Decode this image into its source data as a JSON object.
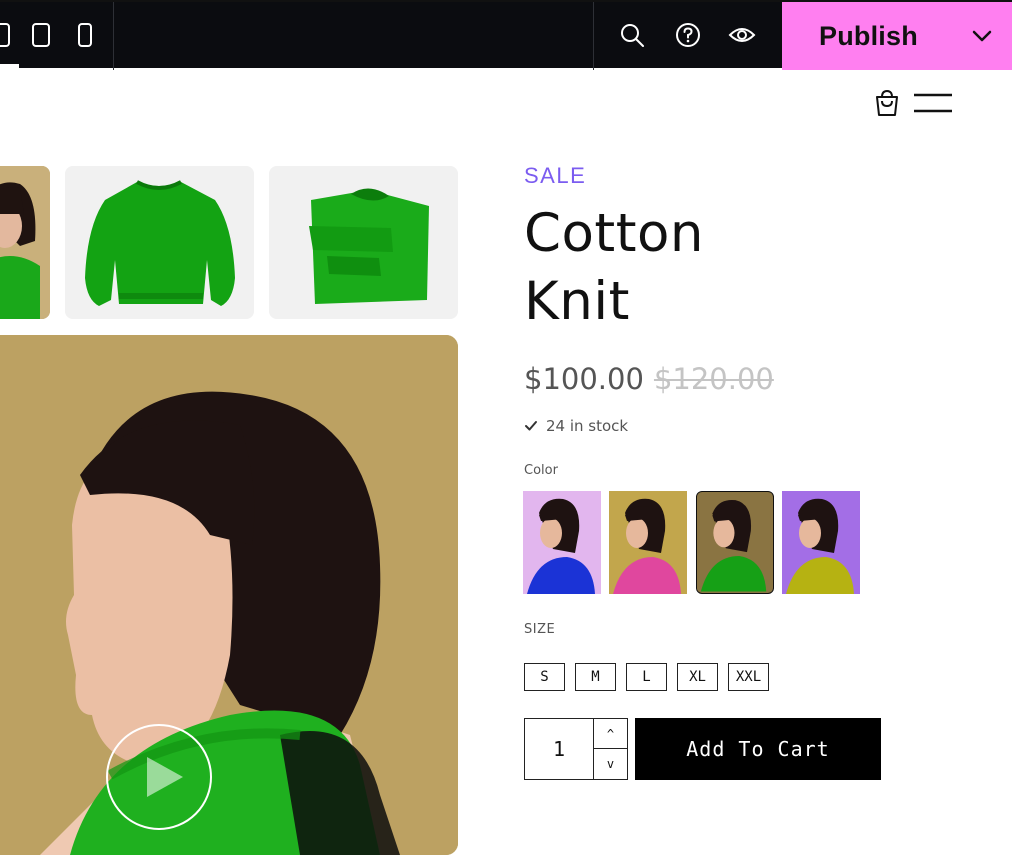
{
  "toolbar": {
    "icons": [
      "desktop-icon",
      "tablet-icon",
      "mobile-icon",
      "search-icon",
      "help-icon",
      "preview-eye-icon"
    ],
    "publish_label": "Publish",
    "publish_color": "#ff7ff0",
    "bar_color": "#0b0c10"
  },
  "header": {
    "icons": [
      "shopping-bag-icon",
      "hamburger-menu-icon"
    ]
  },
  "product": {
    "badge": "SALE",
    "badge_color": "#7b5cf0",
    "title_line1": "Cotton",
    "title_line2": "Knit",
    "price": "$100.00",
    "old_price": "$120.00",
    "stock": "24 in stock",
    "color_label": "Color",
    "color_options": [
      "blue",
      "pink",
      "green",
      "yellow"
    ],
    "selected_color": "green",
    "size_label": "SIZE",
    "sizes": [
      "S",
      "M",
      "L",
      "XL",
      "XXL"
    ],
    "quantity": "1",
    "qty_up": "^",
    "qty_down": "v",
    "add_to_cart": "Add To Cart"
  },
  "gallery": {
    "icons": [
      "play-icon"
    ]
  }
}
